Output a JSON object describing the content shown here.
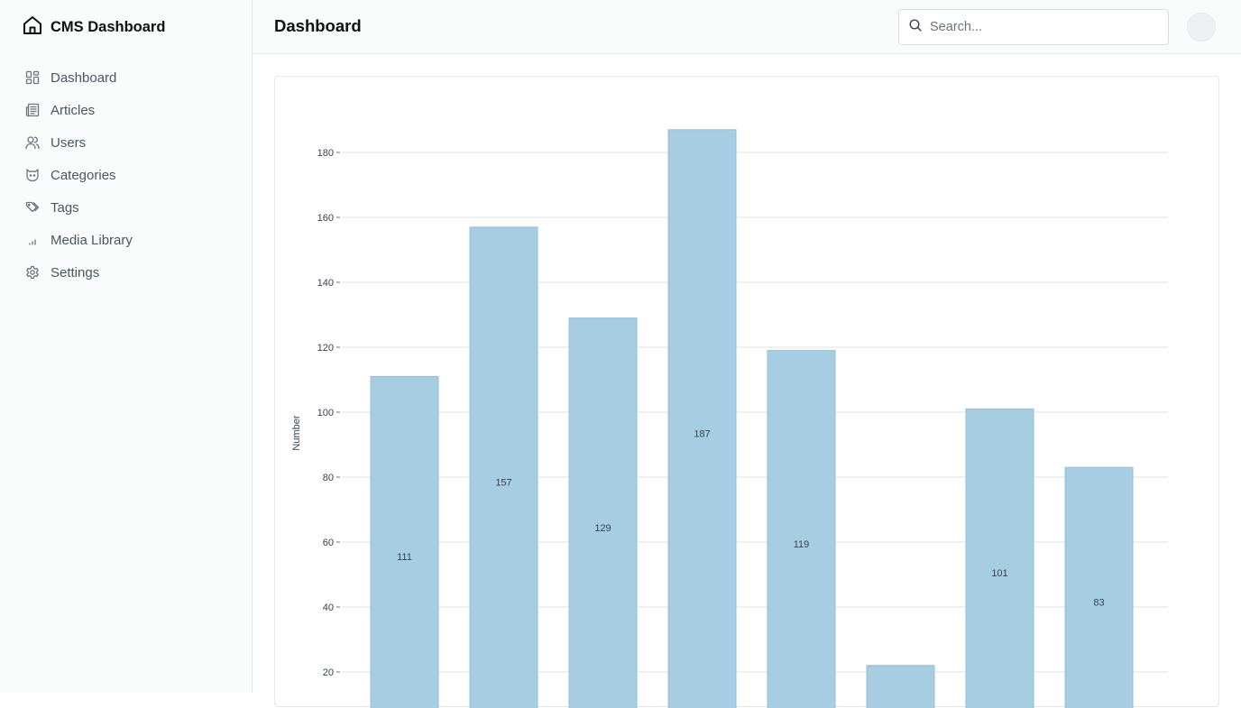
{
  "brand": {
    "title": "CMS Dashboard",
    "icon": "home-icon"
  },
  "sidebar": {
    "items": [
      {
        "label": "Dashboard",
        "icon": "dashboard-grid-icon"
      },
      {
        "label": "Articles",
        "icon": "newspaper-icon"
      },
      {
        "label": "Users",
        "icon": "users-icon"
      },
      {
        "label": "Categories",
        "icon": "cat-icon"
      },
      {
        "label": "Tags",
        "icon": "tags-icon"
      },
      {
        "label": "Media Library",
        "icon": "bar-chart-icon"
      },
      {
        "label": "Settings",
        "icon": "gear-icon"
      }
    ]
  },
  "header": {
    "title": "Dashboard",
    "search": {
      "placeholder": "Search...",
      "value": ""
    }
  },
  "colors": {
    "bar_fill": "#a6cde1",
    "bar_stroke": "#96c0d6",
    "grid": "#e9ebee",
    "icon": "#6b7280"
  },
  "chart_data": {
    "type": "bar",
    "title": "",
    "xlabel": "",
    "ylabel": "Number",
    "ylim": [
      0,
      190
    ],
    "yticks": [
      20,
      40,
      60,
      80,
      100,
      120,
      140,
      160,
      180
    ],
    "grid": true,
    "values": [
      111,
      157,
      129,
      187,
      119,
      22,
      101,
      83
    ],
    "value_labels": [
      "111",
      "157",
      "129",
      "187",
      "119",
      "",
      "101",
      "83"
    ]
  }
}
